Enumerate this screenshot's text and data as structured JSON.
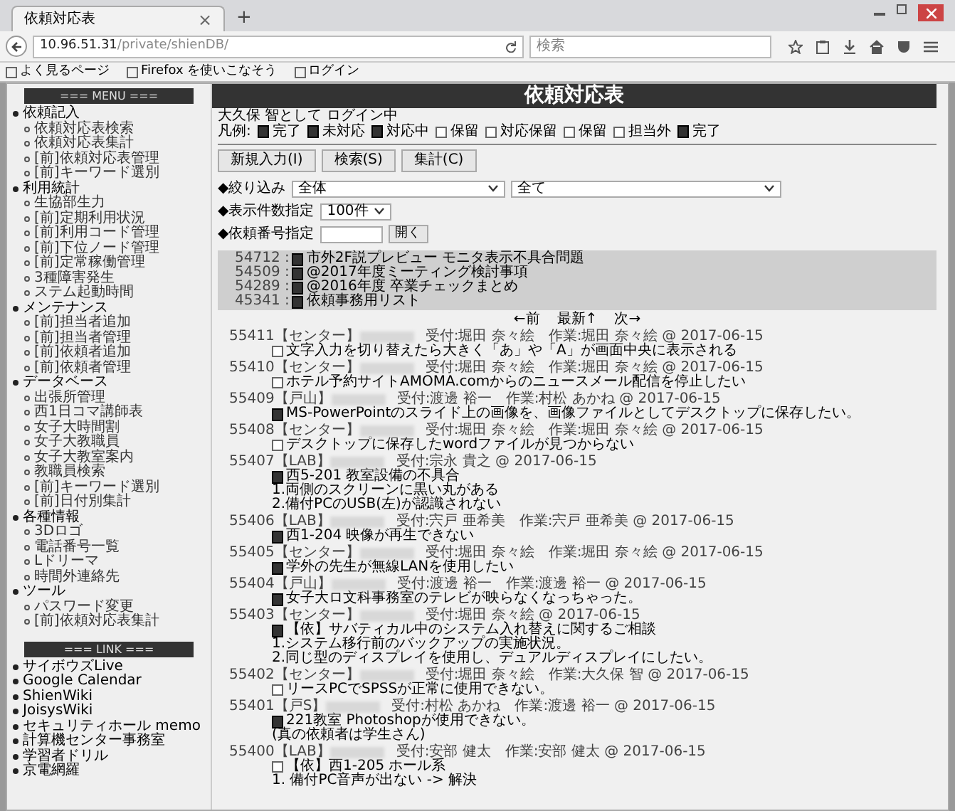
{
  "browser": {
    "tab_title": "依頼対応表",
    "tab_close": "×",
    "new_tab": "+",
    "url_host": "10.96.51.31",
    "url_path": "/private/shienDB/",
    "search_placeholder": "検索",
    "bookmarks": [
      "よく見るページ",
      "Firefox を使いこなそう",
      "ログイン"
    ]
  },
  "page_title": "依頼対応表",
  "sidebar": {
    "menu_heading": "=== MENU ===",
    "sections": [
      {
        "label": "依頼記入",
        "children": [
          "依頼対応表検索",
          "依頼対応表集計",
          "[前]依頼対応表管理",
          "[前]キーワード選別"
        ]
      },
      {
        "label": "利用統計",
        "children": [
          "生協部生力",
          "[前]定期利用状況",
          "[前]利用コード管理",
          "[前]下位ノード管理",
          "[前]定常稼働管理",
          "3種障害発生",
          "ステム起動時間"
        ]
      },
      {
        "label": "メンテナンス",
        "children": [
          "[前]担当者追加",
          "[前]担当者管理",
          "[前]依頼者追加",
          "[前]依頼者管理"
        ]
      },
      {
        "label": "データベース",
        "children": [
          "出張所管理",
          "西1日コマ講師表",
          "女子大時間割",
          "女子大教職員",
          "女子大教室案内",
          "教職員検索",
          "[前]キーワード選別",
          "[前]日付別集計"
        ]
      },
      {
        "label": "各種情報",
        "children": [
          "3Dロゴ",
          "電話番号一覧",
          "Lドリーマ",
          "時間外連絡先"
        ]
      },
      {
        "label": "ツール",
        "children": [
          "パスワード変更",
          "[前]依頼対応表集計"
        ]
      }
    ],
    "link_heading": "=== LINK ===",
    "links": [
      "サイボウズLive",
      "Google Calendar",
      "ShienWiki",
      "JoisysWiki",
      "セキュリティホール memo",
      "計算機センター事務室",
      "学習者ドリル",
      "京電網羅"
    ]
  },
  "login_status": "大久保 智として ログイン中",
  "legend": {
    "label": "凡例:",
    "items": [
      {
        "kind": "filled",
        "label": "完了"
      },
      {
        "kind": "filled",
        "label": "未対応"
      },
      {
        "kind": "filled",
        "label": "対応中"
      },
      {
        "kind": "outline",
        "label": "保留"
      },
      {
        "kind": "outline",
        "label": "対応保留"
      },
      {
        "kind": "outline",
        "label": "保留"
      },
      {
        "kind": "outline",
        "label": "担当外"
      },
      {
        "kind": "filled",
        "label": "完了"
      }
    ]
  },
  "buttons": [
    "新規入力(I)",
    "検索(S)",
    "集計(C)"
  ],
  "filters": {
    "narrow_label": "◆絞り込み",
    "narrow_value_1": "全体",
    "narrow_value_2": "全て",
    "count_label": "◆表示件数指定",
    "count_value": "100件",
    "id_label": "◆依頼番号指定",
    "open_button": "開く"
  },
  "pinned": [
    {
      "id": "54712 :",
      "kind": "filled",
      "text": "市外2F説プレビュー モニタ表示不具合問題"
    },
    {
      "id": "54509 :",
      "kind": "filled",
      "text": "@2017年度ミーティング検討事項"
    },
    {
      "id": "54289 :",
      "kind": "filled",
      "text": "@2016年度 卒業チェックまとめ"
    },
    {
      "id": "45341 :",
      "kind": "filled",
      "text": "依頼事務用リスト"
    }
  ],
  "pager": {
    "prev": "←前",
    "latest": "最新↑",
    "next": "次→"
  },
  "entries": [
    {
      "id": "55411",
      "group": "【センター】",
      "people": "受付:堀田 奈々絵　作業:堀田 奈々絵 @ 2017-06-15",
      "kind": "outline",
      "lines": [
        "文字入力を切り替えたら大きく「あ」や「A」が画面中央に表示される"
      ]
    },
    {
      "id": "55410",
      "group": "【センター】",
      "people": "受付:堀田 奈々絵　作業:堀田 奈々絵 @ 2017-06-15",
      "kind": "outline",
      "lines": [
        "ホテル予約サイトAMOMA.comからのニュースメール配信を停止したい"
      ]
    },
    {
      "id": "55409",
      "group": "【戸山】",
      "people": "受付:渡邊 裕一　作業:村松 あかね @ 2017-06-15",
      "kind": "filled",
      "lines": [
        "MS-PowerPointのスライド上の画像を、画像ファイルとしてデスクトップに保存したい。"
      ]
    },
    {
      "id": "55408",
      "group": "【センター】",
      "people": "受付:堀田 奈々絵　作業:堀田 奈々絵 @ 2017-06-15",
      "kind": "outline",
      "lines": [
        "デスクトップに保存したwordファイルが見つからない"
      ]
    },
    {
      "id": "55407",
      "group": "【LAB】",
      "people": "受付:宗永 貴之 @ 2017-06-15",
      "kind": "filled",
      "lines": [
        "西5-201 教室設備の不具合",
        "1.両側のスクリーンに黒い丸がある",
        "2.備付PCのUSB(左)が認識されない"
      ]
    },
    {
      "id": "55406",
      "group": "【LAB】",
      "people": "受付:宍戸 亜希美　作業:宍戸 亜希美 @ 2017-06-15",
      "kind": "filled",
      "lines": [
        "西1-204 映像が再生できない"
      ]
    },
    {
      "id": "55405",
      "group": "【センター】",
      "people": "受付:堀田 奈々絵　作業:堀田 奈々絵 @ 2017-06-15",
      "kind": "filled",
      "lines": [
        "学外の先生が無線LANを使用したい"
      ]
    },
    {
      "id": "55404",
      "group": "【戸山】",
      "people": "受付:渡邊 裕一　作業:渡邊 裕一 @ 2017-06-15",
      "kind": "filled",
      "lines": [
        "女子大ロ文科事務室のテレビが映らなくなっちゃった。"
      ]
    },
    {
      "id": "55403",
      "group": "【センター】",
      "people": "受付:堀田 奈々絵 @ 2017-06-15",
      "kind": "filled",
      "lines": [
        "【依】サバティカル中のシステム入れ替えに関するご相談",
        "1.システム移行前のバックアップの実施状況。",
        "2.同じ型のディスプレイを使用し、デュアルディスプレイにしたい。"
      ]
    },
    {
      "id": "55402",
      "group": "【センター】",
      "people": "受付:堀田 奈々絵　作業:大久保 智 @ 2017-06-15",
      "kind": "outline",
      "lines": [
        "リースPCでSPSSが正常に使用できない。"
      ]
    },
    {
      "id": "55401",
      "group": "【戸S】",
      "people": "受付:村松 あかね　作業:渡邊 裕一 @ 2017-06-15",
      "kind": "filled",
      "lines": [
        "221教室 Photoshopが使用できない。",
        "(真の依頼者は学生さん)"
      ]
    },
    {
      "id": "55400",
      "group": "【LAB】",
      "people": "受付:安部 健太　作業:安部 健太 @ 2017-06-15",
      "kind": "outline",
      "lines": [
        "【依】西1-205 ホール系",
        "1. 備付PC音声が出ない -> 解決"
      ]
    }
  ]
}
